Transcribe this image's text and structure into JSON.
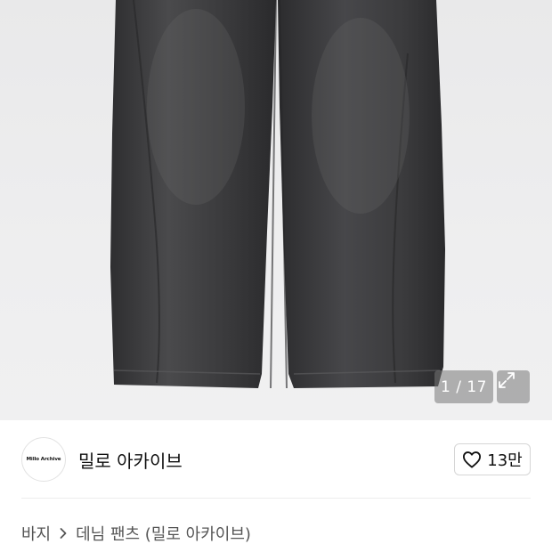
{
  "gallery": {
    "counter": "1 / 17",
    "expand_icon": "expand-arrows-icon",
    "image_alt": "dark washed denim pants"
  },
  "brand": {
    "logo_text": "Millo Archive",
    "name": "밀로 아카이브"
  },
  "like": {
    "icon": "heart-outline-icon",
    "count": "13만"
  },
  "breadcrumb": {
    "items": [
      "바지",
      "데님 팬츠 (밀로 아카이브)"
    ],
    "separator_icon": "chevron-right-icon"
  },
  "colors": {
    "photo_bg": "#ececed",
    "denim": "#3d3d3f",
    "overlay": "#7a7a7a"
  }
}
